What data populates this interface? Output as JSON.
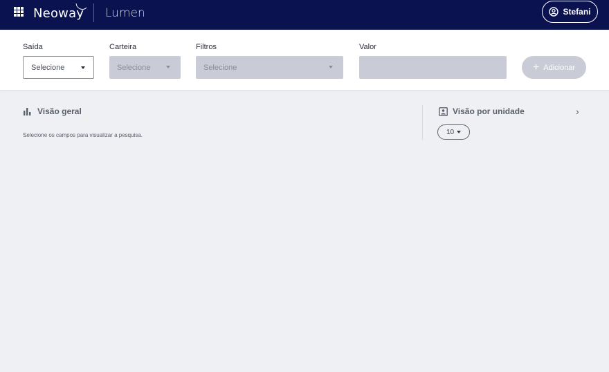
{
  "header": {
    "brand": "Neoway",
    "product": "Lumen",
    "user_name": "Stefani"
  },
  "filters": {
    "saida": {
      "label": "Saída",
      "placeholder": "Selecione"
    },
    "carteira": {
      "label": "Carteira",
      "placeholder": "Selecione"
    },
    "filtros": {
      "label": "Filtros",
      "placeholder": "Selecione"
    },
    "valor": {
      "label": "Valor",
      "value": ""
    },
    "add_label": "Adicionar"
  },
  "overview": {
    "title": "Visão geral",
    "hint": "Selecione os campos para visualizar a pesquisa."
  },
  "unit_view": {
    "title": "Visão por unidade",
    "page_size": "10"
  },
  "colors": {
    "topbar": "#0a1250",
    "background": "#eef0f4",
    "disabled": "#c9ccd6"
  }
}
